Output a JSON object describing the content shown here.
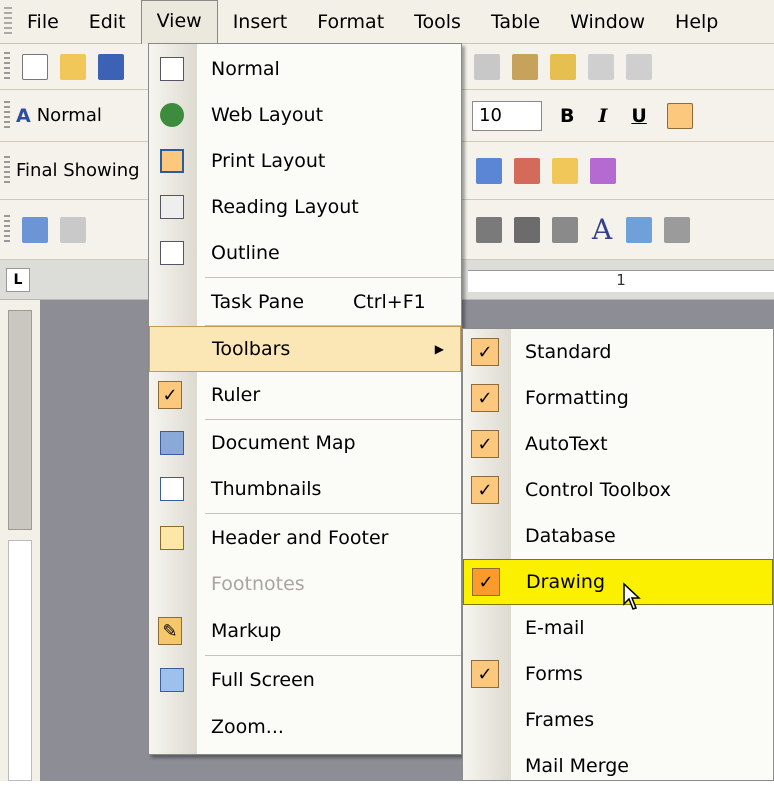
{
  "menubar": {
    "items": [
      "File",
      "Edit",
      "View",
      "Insert",
      "Format",
      "Tools",
      "Table",
      "Window",
      "Help"
    ]
  },
  "toolbars": {
    "style_box": "Normal",
    "font_size": "10",
    "markup_box": "Final Showing"
  },
  "ruler": {
    "mark": "1"
  },
  "view_menu": {
    "items": [
      {
        "label": "Normal",
        "icon": "normal-view-icon"
      },
      {
        "label": "Web Layout",
        "icon": "web-layout-icon"
      },
      {
        "label": "Print Layout",
        "icon": "print-layout-icon"
      },
      {
        "label": "Reading Layout",
        "icon": "reading-layout-icon"
      },
      {
        "label": "Outline",
        "icon": "outline-icon"
      },
      {
        "label": "Task Pane",
        "shortcut": "Ctrl+F1"
      },
      {
        "label": "Toolbars"
      },
      {
        "label": "Ruler",
        "checked": true
      },
      {
        "label": "Document Map",
        "icon": "document-map-icon"
      },
      {
        "label": "Thumbnails",
        "icon": "thumbnails-icon"
      },
      {
        "label": "Header and Footer",
        "icon": "header-footer-icon"
      },
      {
        "label": "Footnotes",
        "disabled": true
      },
      {
        "label": "Markup",
        "icon": "markup-icon"
      },
      {
        "label": "Full Screen",
        "icon": "full-screen-icon"
      },
      {
        "label": "Zoom..."
      }
    ]
  },
  "toolbars_submenu": {
    "items": [
      {
        "label": "Standard",
        "checked": true
      },
      {
        "label": "Formatting",
        "checked": true
      },
      {
        "label": "AutoText",
        "checked": true
      },
      {
        "label": "Control Toolbox",
        "checked": true
      },
      {
        "label": "Database",
        "checked": false
      },
      {
        "label": "Drawing",
        "checked": true
      },
      {
        "label": "E-mail",
        "checked": false
      },
      {
        "label": "Forms",
        "checked": true
      },
      {
        "label": "Frames",
        "checked": false
      },
      {
        "label": "Mail Merge",
        "checked": false
      }
    ]
  },
  "colors": {
    "highlight": "#fbe7b6",
    "hover_yellow": "#fbf000",
    "check_orange": "#fbc87e"
  }
}
